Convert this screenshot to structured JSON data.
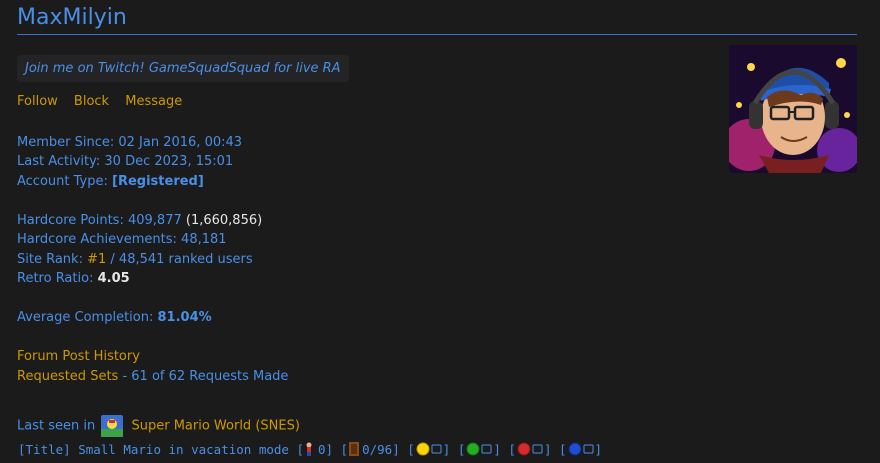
{
  "profile": {
    "username": "MaxMilyin",
    "motto": "Join me on Twitch! GameSquadSquad for live RA",
    "actions": [
      "Follow",
      "Block",
      "Message"
    ]
  },
  "membership": {
    "member_since_label": "Member Since:",
    "member_since": "02 Jan 2016, 00:43",
    "last_activity_label": "Last Activity:",
    "last_activity": "30 Dec 2023, 15:01",
    "account_type_label": "Account Type:",
    "account_type": "[Registered]"
  },
  "stats": {
    "hardcore_points_label": "Hardcore Points:",
    "hardcore_points": "409,877",
    "retro_points": "(1,660,856)",
    "hardcore_achievements_label": "Hardcore Achievements:",
    "hardcore_achievements": "48,181",
    "site_rank_label": "Site Rank:",
    "site_rank": "#1",
    "site_rank_total": "/ 48,541 ranked users",
    "retro_ratio_label": "Retro Ratio:",
    "retro_ratio": "4.05",
    "avg_completion_label": "Average Completion:",
    "avg_completion": "81.04%"
  },
  "links": {
    "forum_history": "Forum Post History",
    "requested_sets": "Requested Sets",
    "requests_made": "- 61 of 62 Requests Made"
  },
  "last_seen": {
    "label": "Last seen in",
    "game": "Super Mario World (SNES)",
    "rich_presence_prefix": "[Title] Small Mario in vacation mode [",
    "lives": "0] [",
    "exits": "0/96] [",
    "seg1": "] [",
    "seg2": "] [",
    "seg3": "] [",
    "seg4": "]"
  },
  "colors": {
    "background": "#1b1b1c",
    "link_blue": "#4a8fe6",
    "gold": "#cc9900"
  }
}
